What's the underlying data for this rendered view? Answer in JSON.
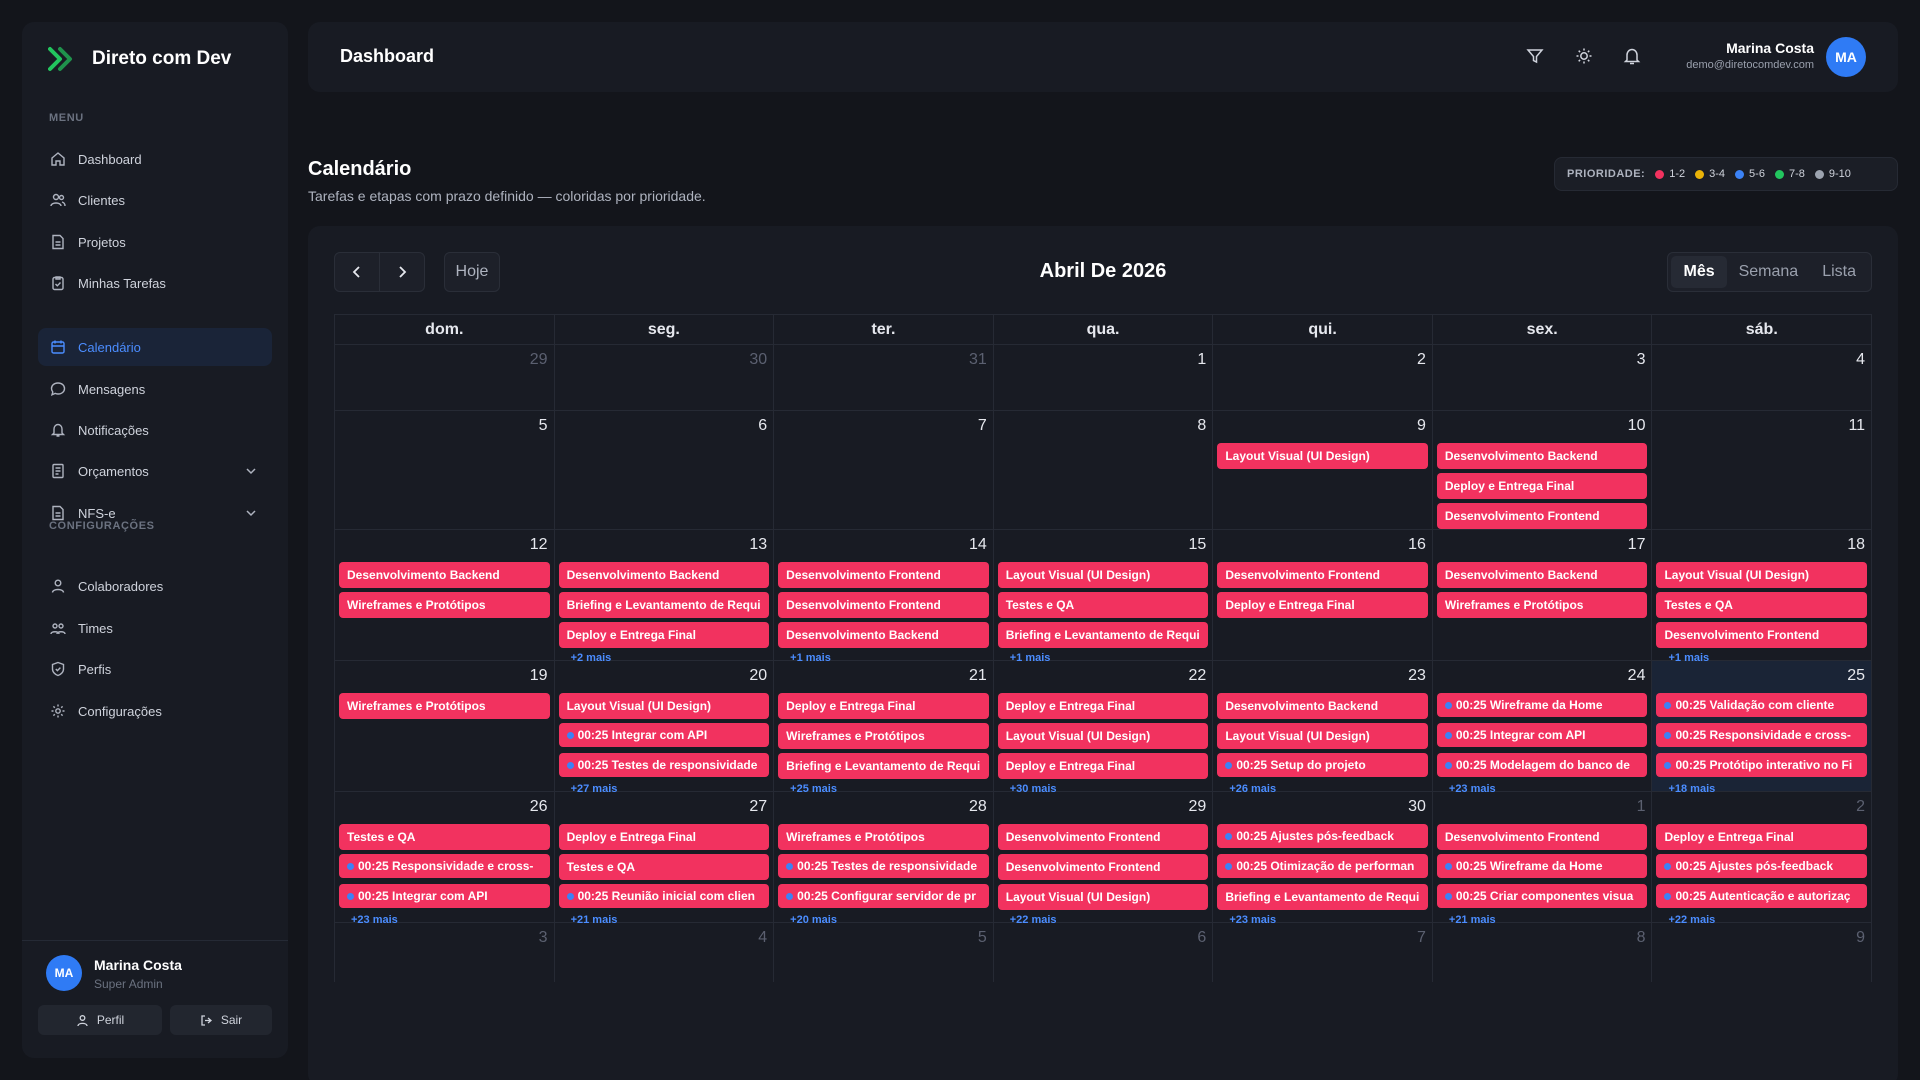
{
  "brand": {
    "name": "Direto com Dev",
    "accent": "#22c55e"
  },
  "sidebar": {
    "menu_label": "MENU",
    "settings_label": "CONFIGURAÇÕES",
    "items": [
      {
        "label": "Dashboard",
        "icon": "home-icon"
      },
      {
        "label": "Clientes",
        "icon": "users-icon"
      },
      {
        "label": "Projetos",
        "icon": "file-icon"
      },
      {
        "label": "Minhas Tarefas",
        "icon": "clipboard-icon"
      },
      {
        "label": "Calendário",
        "icon": "calendar-icon",
        "active": true
      },
      {
        "label": "Mensagens",
        "icon": "chat-icon"
      },
      {
        "label": "Notificações",
        "icon": "bell-icon"
      },
      {
        "label": "Orçamentos",
        "icon": "document-icon",
        "expandable": true
      },
      {
        "label": "NFS-e",
        "icon": "document-icon",
        "expandable": true
      }
    ],
    "settings_items": [
      {
        "label": "Colaboradores",
        "icon": "user-group-icon"
      },
      {
        "label": "Times",
        "icon": "team-icon"
      },
      {
        "label": "Perfis",
        "icon": "shield-icon"
      },
      {
        "label": "Configurações",
        "icon": "gear-icon"
      }
    ],
    "user": {
      "initials": "MA",
      "name": "Marina Costa",
      "role": "Super Admin",
      "profile_label": "Perfil",
      "logout_label": "Sair"
    }
  },
  "topbar": {
    "title": "Dashboard",
    "user_name": "Marina Costa",
    "user_email": "demo@diretocomdev.com",
    "initials": "MA"
  },
  "page": {
    "title": "Calendário",
    "subtitle": "Tarefas e etapas com prazo definido — coloridas por prioridade."
  },
  "priority": {
    "label": "PRIORIDADE:",
    "items": [
      {
        "label": "1-2",
        "color": "#f2325f"
      },
      {
        "label": "3-4",
        "color": "#eab308"
      },
      {
        "label": "5-6",
        "color": "#3b82f6"
      },
      {
        "label": "7-8",
        "color": "#22c55e"
      },
      {
        "label": "9-10",
        "color": "#9ca3af"
      }
    ]
  },
  "calendar": {
    "today_label": "Hoje",
    "month_title": "Abril De 2026",
    "views": [
      "Mês",
      "Semana",
      "Lista"
    ],
    "active_view": "Mês",
    "weekdays": [
      "dom.",
      "seg.",
      "ter.",
      "qua.",
      "qui.",
      "sex.",
      "sáb."
    ],
    "event_color": "#f2325f",
    "weeks": [
      {
        "h": 66,
        "days": [
          {
            "d": "29",
            "o": true,
            "ev": []
          },
          {
            "d": "30",
            "o": true,
            "ev": []
          },
          {
            "d": "31",
            "o": true,
            "ev": []
          },
          {
            "d": "1",
            "ev": []
          },
          {
            "d": "2",
            "ev": []
          },
          {
            "d": "3",
            "ev": []
          },
          {
            "d": "4",
            "ev": []
          }
        ]
      },
      {
        "h": 146,
        "days": [
          {
            "d": "5",
            "ev": []
          },
          {
            "d": "6",
            "ev": []
          },
          {
            "d": "7",
            "ev": []
          },
          {
            "d": "8",
            "ev": []
          },
          {
            "d": "9",
            "ev": [
              "Layout Visual (UI Design)"
            ]
          },
          {
            "d": "10",
            "ev": [
              "Desenvolvimento Backend",
              "Deploy e Entrega Final",
              "Desenvolvimento Frontend"
            ]
          },
          {
            "d": "11",
            "ev": []
          }
        ]
      },
      {
        "h": 161,
        "days": [
          {
            "d": "12",
            "ev": [
              "Desenvolvimento Backend",
              "Wireframes e Protótipos"
            ]
          },
          {
            "d": "13",
            "ev": [
              "Desenvolvimento Backend",
              "Briefing e Levantamento de Requi",
              "Deploy e Entrega Final"
            ],
            "more": "+2 mais"
          },
          {
            "d": "14",
            "ev": [
              "Desenvolvimento Frontend",
              "Desenvolvimento Frontend",
              "Desenvolvimento Backend"
            ],
            "more": "+1 mais"
          },
          {
            "d": "15",
            "ev": [
              "Layout Visual (UI Design)",
              "Testes e QA",
              "Briefing e Levantamento de Requi"
            ],
            "more": "+1 mais"
          },
          {
            "d": "16",
            "ev": [
              "Desenvolvimento Frontend",
              "Deploy e Entrega Final"
            ]
          },
          {
            "d": "17",
            "ev": [
              "Desenvolvimento Backend",
              "Wireframes e Protótipos"
            ]
          },
          {
            "d": "18",
            "ev": [
              "Layout Visual (UI Design)",
              "Testes e QA",
              "Desenvolvimento Frontend"
            ],
            "more": "+1 mais"
          }
        ]
      },
      {
        "h": 161,
        "days": [
          {
            "d": "19",
            "ev": [
              "Wireframes e Protótipos"
            ]
          },
          {
            "d": "20",
            "ev": [
              "Layout Visual (UI Design)",
              {
                "t": "00:25 Integrar com API"
              },
              {
                "t": "00:25 Testes de responsividade"
              }
            ],
            "more": "+27 mais"
          },
          {
            "d": "21",
            "ev": [
              "Deploy e Entrega Final",
              "Wireframes e Protótipos",
              "Briefing e Levantamento de Requi"
            ],
            "more": "+25 mais"
          },
          {
            "d": "22",
            "ev": [
              "Deploy e Entrega Final",
              "Layout Visual (UI Design)",
              "Deploy e Entrega Final"
            ],
            "more": "+30 mais"
          },
          {
            "d": "23",
            "ev": [
              "Desenvolvimento Backend",
              "Layout Visual (UI Design)",
              {
                "t": "00:25 Setup do projeto"
              }
            ],
            "more": "+26 mais"
          },
          {
            "d": "24",
            "ev": [
              {
                "t": "00:25 Wireframe da Home"
              },
              {
                "t": "00:25 Integrar com API"
              },
              {
                "t": "00:25 Modelagem do banco de"
              }
            ],
            "more": "+23 mais"
          },
          {
            "d": "25",
            "today": true,
            "ev": [
              {
                "t": "00:25 Validação com cliente"
              },
              {
                "t": "00:25 Responsividade e cross-"
              },
              {
                "t": "00:25 Protótipo interativo no Fi"
              }
            ],
            "more": "+18 mais"
          }
        ]
      },
      {
        "h": 161,
        "days": [
          {
            "d": "26",
            "ev": [
              "Testes e QA",
              {
                "t": "00:25 Responsividade e cross-"
              },
              {
                "t": "00:25 Integrar com API"
              }
            ],
            "more": "+23 mais"
          },
          {
            "d": "27",
            "ev": [
              "Deploy e Entrega Final",
              "Testes e QA",
              {
                "t": "00:25 Reunião inicial com clien"
              }
            ],
            "more": "+21 mais"
          },
          {
            "d": "28",
            "ev": [
              "Wireframes e Protótipos",
              {
                "t": "00:25 Testes de responsividade"
              },
              {
                "t": "00:25 Configurar servidor de pr"
              }
            ],
            "more": "+20 mais"
          },
          {
            "d": "29",
            "ev": [
              "Desenvolvimento Frontend",
              "Desenvolvimento Frontend",
              "Layout Visual (UI Design)"
            ],
            "more": "+22 mais"
          },
          {
            "d": "30",
            "ev": [
              {
                "t": "00:25 Ajustes pós-feedback"
              },
              {
                "t": "00:25 Otimização de performan"
              },
              "Briefing e Levantamento de Requi"
            ],
            "more": "+23 mais"
          },
          {
            "d": "1",
            "o": true,
            "ev": [
              "Desenvolvimento Frontend",
              {
                "t": "00:25 Wireframe da Home"
              },
              {
                "t": "00:25 Criar componentes visua"
              }
            ],
            "more": "+21 mais"
          },
          {
            "d": "2",
            "o": true,
            "ev": [
              "Deploy e Entrega Final",
              {
                "t": "00:25 Ajustes pós-feedback"
              },
              {
                "t": "00:25 Autenticação e autorizaç"
              }
            ],
            "more": "+22 mais"
          }
        ]
      },
      {
        "h": 40,
        "days": [
          {
            "d": "3",
            "o": true,
            "ev": []
          },
          {
            "d": "4",
            "o": true,
            "ev": []
          },
          {
            "d": "5",
            "o": true,
            "ev": []
          },
          {
            "d": "6",
            "o": true,
            "ev": []
          },
          {
            "d": "7",
            "o": true,
            "ev": []
          },
          {
            "d": "8",
            "o": true,
            "ev": []
          },
          {
            "d": "9",
            "o": true,
            "ev": []
          }
        ]
      }
    ]
  }
}
